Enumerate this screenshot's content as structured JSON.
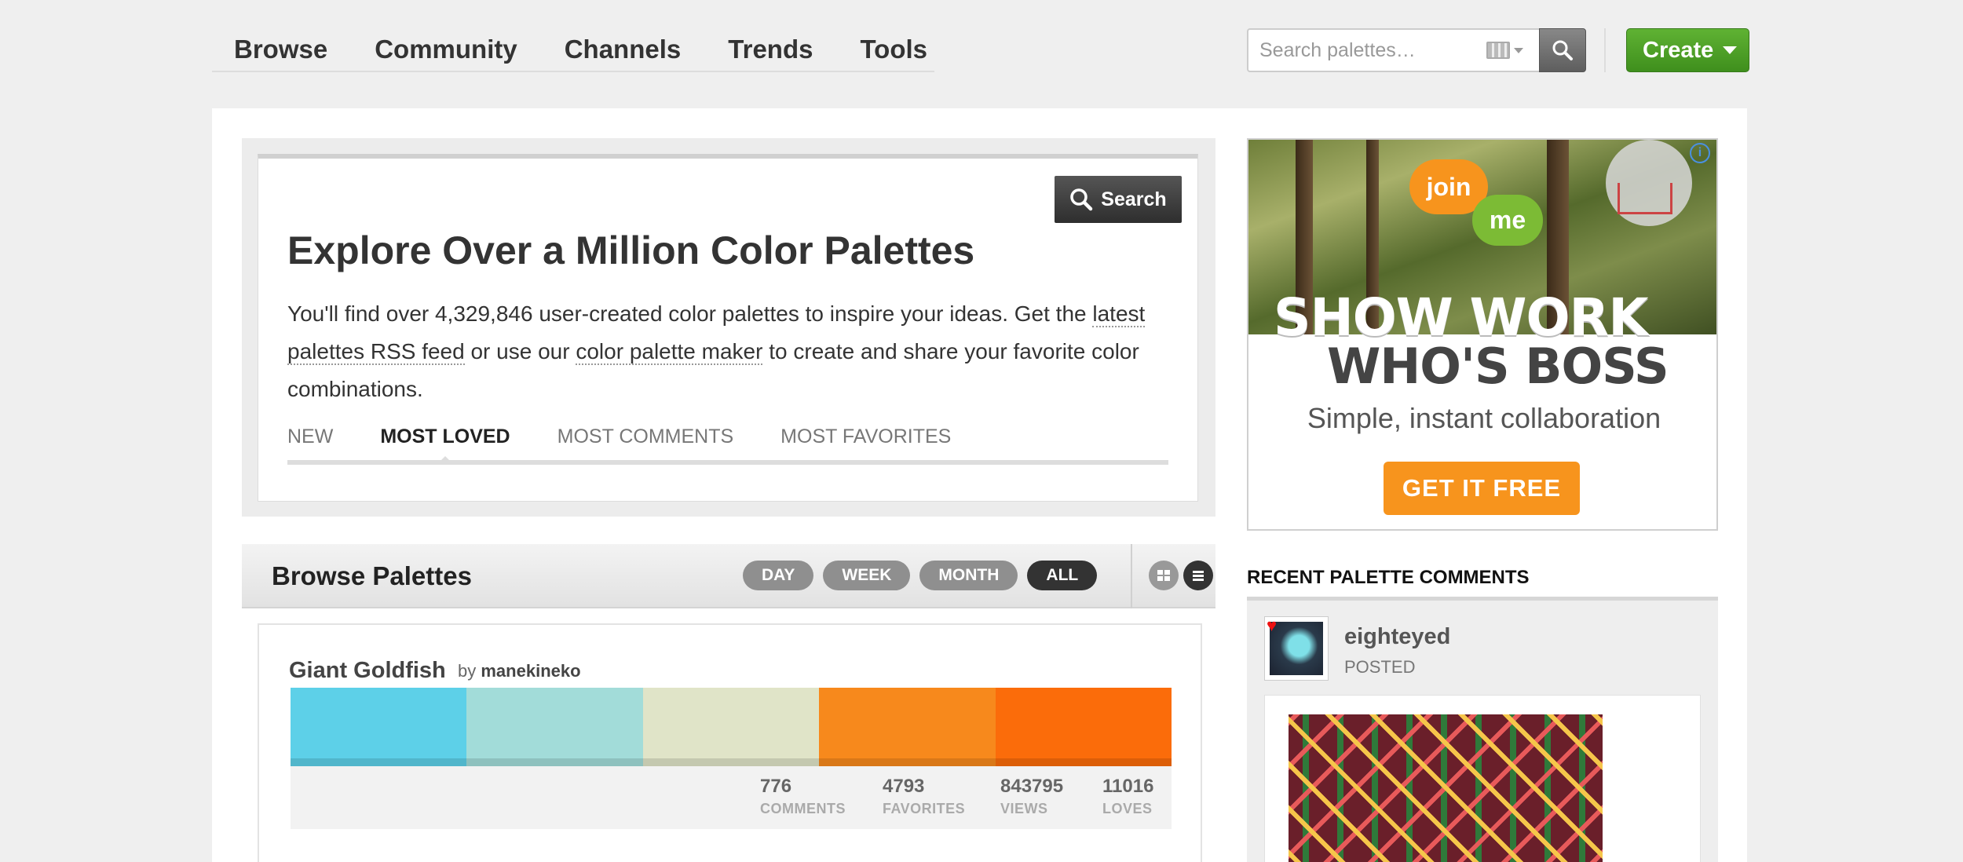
{
  "nav": {
    "items": [
      "Browse",
      "Community",
      "Channels",
      "Trends",
      "Tools"
    ],
    "search_placeholder": "Search palettes…",
    "create_label": "Create"
  },
  "explore": {
    "search_button": "Search",
    "title": "Explore Over a Million Color Palettes",
    "desc_part1": "You'll find over 4,329,846 user-created color palettes to inspire your ideas. Get the ",
    "desc_link1": "latest palettes RSS feed",
    "desc_part2": " or use our ",
    "desc_link2": "color palette maker",
    "desc_part3": " to create and share your favorite color combinations.",
    "tabs": [
      "NEW",
      "MOST LOVED",
      "MOST COMMENTS",
      "MOST FAVORITES"
    ],
    "active_tab": "MOST LOVED"
  },
  "browse": {
    "title": "Browse Palettes",
    "ranges": [
      "DAY",
      "WEEK",
      "MONTH",
      "ALL"
    ],
    "active_range": "ALL",
    "view_modes": [
      "grid-icon",
      "list-icon"
    ]
  },
  "palette": {
    "title": "Giant Goldfish",
    "by": "by",
    "author": "manekineko",
    "colors": [
      "#5dd0e8",
      "#a2dcd9",
      "#e0e4c8",
      "#f7891c",
      "#fb6c0a"
    ],
    "stats": [
      {
        "num": "776",
        "label": "COMMENTS"
      },
      {
        "num": "4793",
        "label": "FAVORITES"
      },
      {
        "num": "843795",
        "label": "VIEWS"
      },
      {
        "num": "11016",
        "label": "LOVES"
      }
    ]
  },
  "ad": {
    "bubble1": "join",
    "bubble2": "me",
    "headline1": "SHOW WORK",
    "headline2": "WHO'S BOSS",
    "tagline": "Simple, instant collaboration",
    "cta": "GET IT FREE",
    "info_icon": "ad-info-icon"
  },
  "recent": {
    "heading": "RECENT PALETTE COMMENTS",
    "user": "eighteyed",
    "action": "POSTED"
  },
  "colors": {
    "create_green": "#4a9d26",
    "ad_orange": "#f7941d",
    "ad_green": "#7cbb35"
  }
}
